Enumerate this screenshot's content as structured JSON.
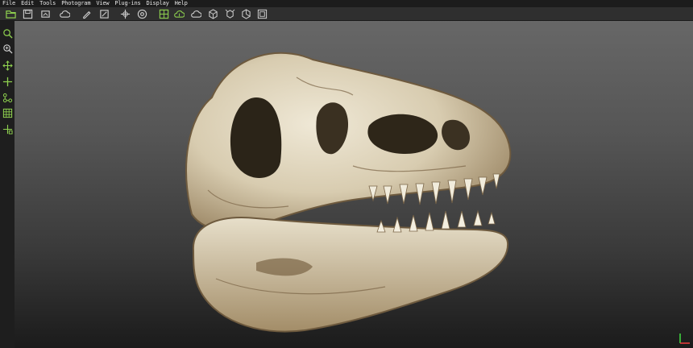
{
  "menu": {
    "items": [
      "File",
      "Edit",
      "Tools",
      "Photogram",
      "View",
      "Plug-ins",
      "Display",
      "Help"
    ]
  },
  "toolbar": {
    "buttons": [
      {
        "name": "open-folder-icon",
        "color": "#8fd14f"
      },
      {
        "name": "save-icon",
        "color": "#cfcfcf"
      },
      {
        "name": "export-icon",
        "color": "#cfcfcf"
      },
      {
        "name": "image-icon",
        "color": "#cfcfcf"
      },
      {
        "name": "cloud-icon",
        "color": "#cfcfcf"
      },
      {
        "name": "brush-icon",
        "color": "#cfcfcf"
      },
      {
        "name": "edit-icon",
        "color": "#cfcfcf"
      },
      {
        "name": "move-icon",
        "color": "#cfcfcf"
      },
      {
        "name": "target-icon",
        "color": "#cfcfcf"
      },
      {
        "name": "mesh-icon",
        "color": "#8fd14f"
      },
      {
        "name": "cloud-sync-icon",
        "color": "#8fd14f"
      },
      {
        "name": "cloud-outline-icon",
        "color": "#cfcfcf"
      },
      {
        "name": "cube-icon",
        "color": "#cfcfcf"
      },
      {
        "name": "cube-arrows-icon",
        "color": "#cfcfcf"
      },
      {
        "name": "cube-alt-icon",
        "color": "#cfcfcf"
      },
      {
        "name": "cube-frame-icon",
        "color": "#cfcfcf"
      }
    ]
  },
  "side_tools": [
    {
      "name": "zoom-icon",
      "color": "#8fd14f"
    },
    {
      "name": "zoom-region-icon",
      "color": "#8fd14f"
    },
    {
      "name": "pan-icon",
      "color": "#8fd14f"
    },
    {
      "name": "move-axis-icon",
      "color": "#8fd14f"
    },
    {
      "name": "nodes-icon",
      "color": "#8fd14f"
    },
    {
      "name": "grid-icon",
      "color": "#8fd14f"
    },
    {
      "name": "transform-icon",
      "color": "#8fd14f"
    }
  ],
  "viewport": {
    "object": "skull-model",
    "axis_colors": {
      "x": "#e33b3b",
      "y": "#3fd23f"
    }
  }
}
